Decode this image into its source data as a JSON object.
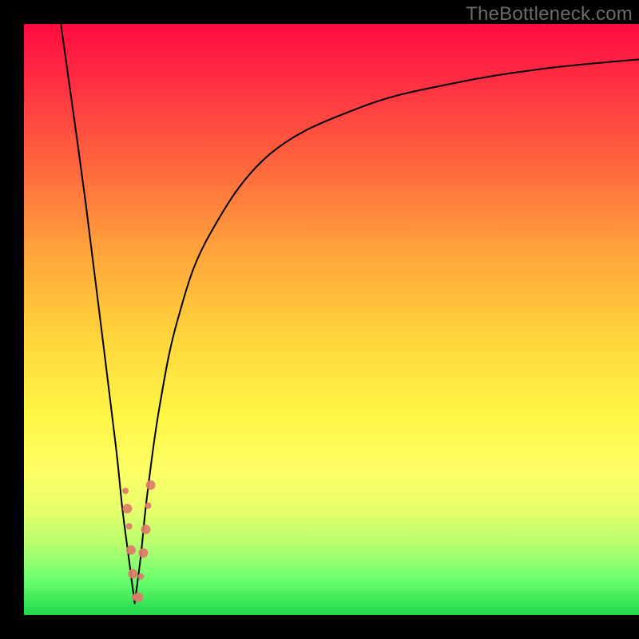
{
  "watermark": "TheBottleneck.com",
  "chart_data": {
    "type": "line",
    "title": "",
    "xlabel": "",
    "ylabel": "",
    "xlim": [
      0,
      100
    ],
    "ylim": [
      0,
      100
    ],
    "background_gradient": {
      "orientation": "vertical",
      "stops": [
        {
          "pos": 0.0,
          "color": "#ff0b3f"
        },
        {
          "pos": 0.1,
          "color": "#ff2f42"
        },
        {
          "pos": 0.25,
          "color": "#ff6b3d"
        },
        {
          "pos": 0.38,
          "color": "#ffa23b"
        },
        {
          "pos": 0.52,
          "color": "#ffd23b"
        },
        {
          "pos": 0.66,
          "color": "#fff645"
        },
        {
          "pos": 0.76,
          "color": "#fcff66"
        },
        {
          "pos": 0.82,
          "color": "#e8ff6a"
        },
        {
          "pos": 0.88,
          "color": "#b8ff6e"
        },
        {
          "pos": 0.94,
          "color": "#6bff6e"
        },
        {
          "pos": 1.0,
          "color": "#1fd94a"
        }
      ]
    },
    "series": [
      {
        "name": "left-branch",
        "color": "#000000",
        "stroke_width": 2,
        "x": [
          6.0,
          10.0,
          13.0,
          15.0,
          16.0,
          17.0,
          17.5,
          18.0
        ],
        "y": [
          100.0,
          70.0,
          45.0,
          28.0,
          18.0,
          10.0,
          6.0,
          2.0
        ]
      },
      {
        "name": "right-branch",
        "color": "#000000",
        "stroke_width": 2,
        "x": [
          18.0,
          19.0,
          20.0,
          22.0,
          25.0,
          30.0,
          40.0,
          55.0,
          70.0,
          85.0,
          100.0
        ],
        "y": [
          2.0,
          10.0,
          20.0,
          35.0,
          50.0,
          64.0,
          78.0,
          86.0,
          90.0,
          92.5,
          94.0
        ]
      }
    ],
    "markers": {
      "name": "highlight-dots",
      "color": "#e07a6b",
      "radius_pattern": [
        4,
        6,
        4,
        6,
        6,
        4,
        6,
        4,
        6,
        6,
        4,
        6
      ],
      "points": [
        {
          "x": 16.5,
          "y": 21.0
        },
        {
          "x": 16.8,
          "y": 18.0
        },
        {
          "x": 17.1,
          "y": 15.0
        },
        {
          "x": 17.4,
          "y": 11.0
        },
        {
          "x": 17.7,
          "y": 7.0
        },
        {
          "x": 18.0,
          "y": 3.0
        },
        {
          "x": 18.6,
          "y": 3.0
        },
        {
          "x": 19.0,
          "y": 6.5
        },
        {
          "x": 19.4,
          "y": 10.5
        },
        {
          "x": 19.8,
          "y": 14.5
        },
        {
          "x": 20.2,
          "y": 18.5
        },
        {
          "x": 20.6,
          "y": 22.0
        }
      ]
    }
  }
}
